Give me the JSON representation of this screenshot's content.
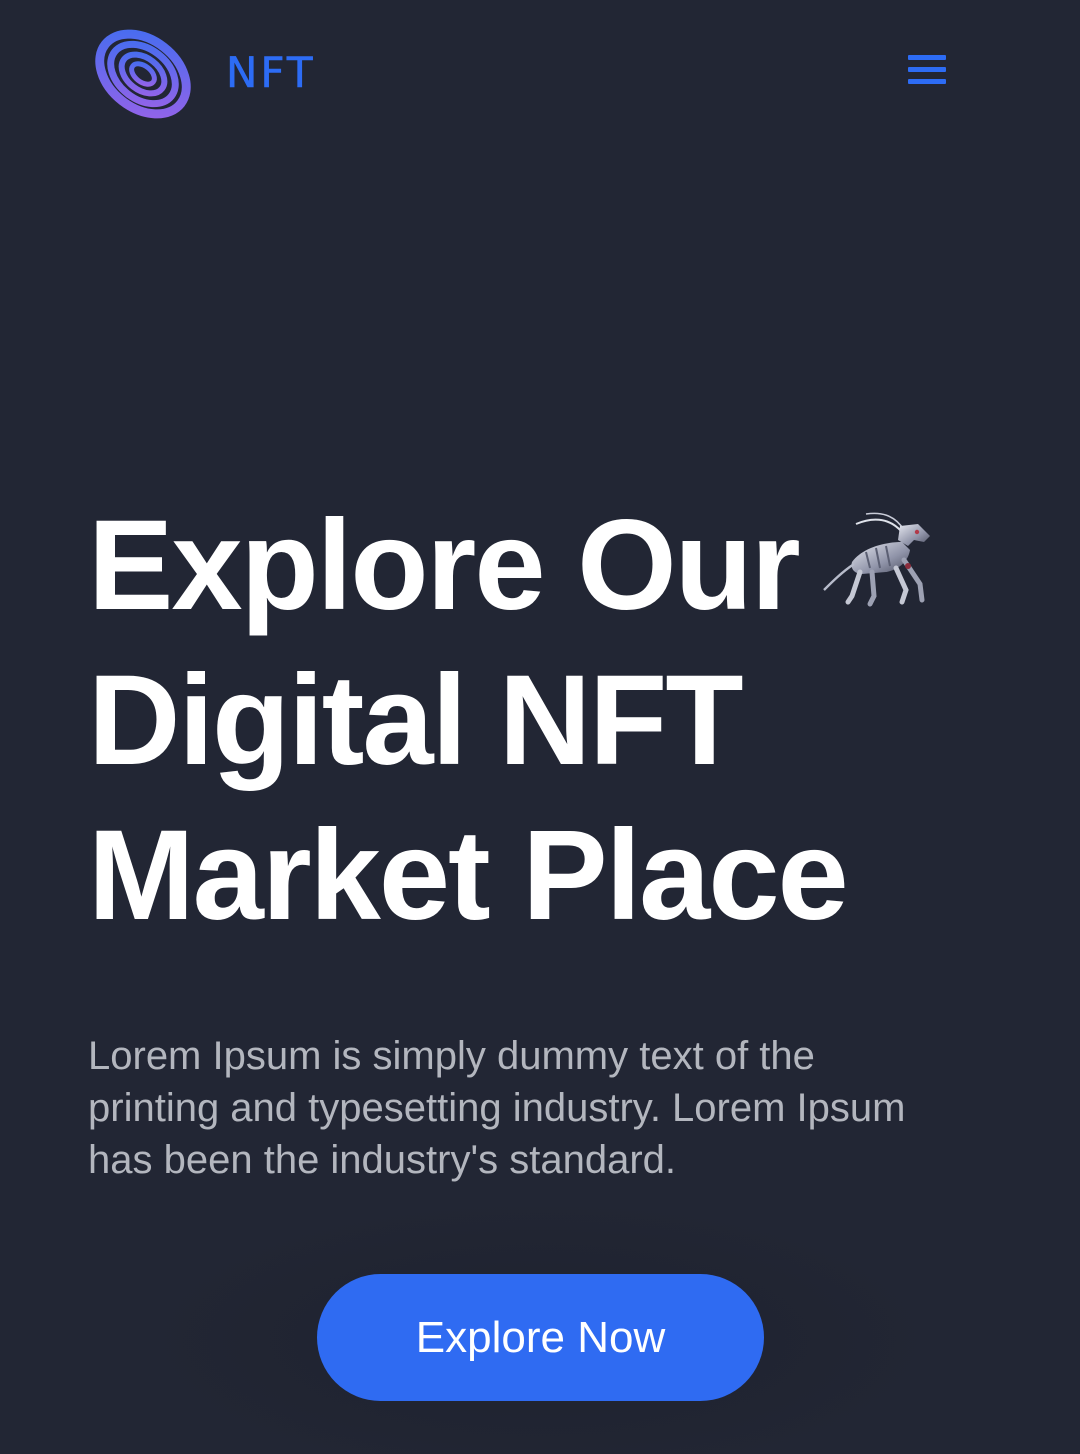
{
  "header": {
    "logo_text": "NFT",
    "logo_icon": "rings-logo-icon",
    "menu_icon": "hamburger-menu-icon"
  },
  "hero": {
    "title_lines": [
      "Explore Our",
      "Digital NFT",
      "Market Place"
    ],
    "art_icon": "nft-creature-icon",
    "description": "Lorem Ipsum is simply dummy text of the printing and typesetting industry. Lorem Ipsum has been the industry's standard.",
    "cta_label": "Explore Now"
  },
  "colors": {
    "background": "#222634",
    "accent": "#2f6bf2",
    "title": "#ffffff",
    "body_text": "#b3b6be"
  }
}
